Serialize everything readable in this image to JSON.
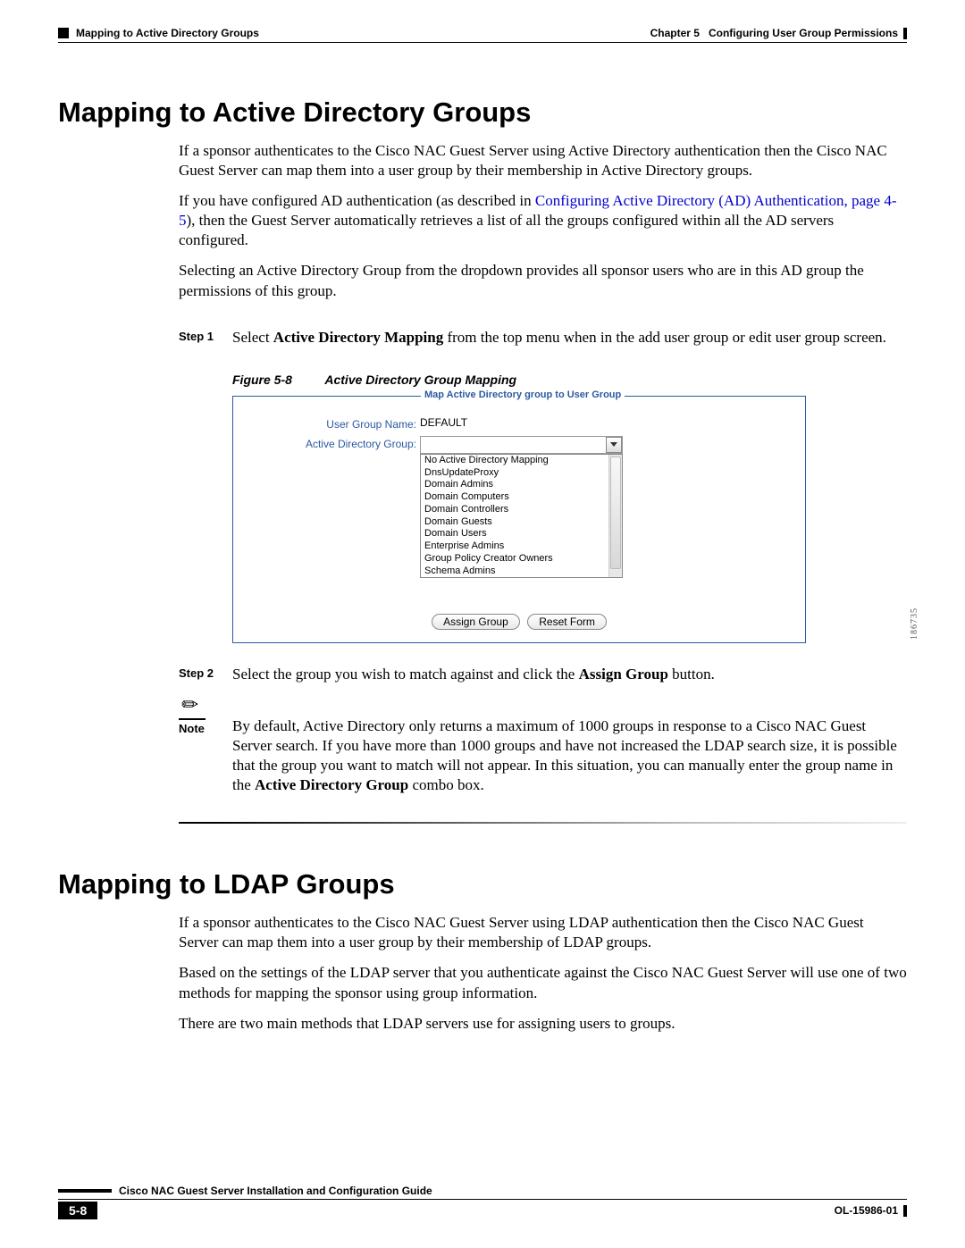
{
  "header": {
    "section_title": "Mapping to Active Directory Groups",
    "chapter_label": "Chapter 5",
    "chapter_title": "Configuring User Group Permissions"
  },
  "h1": "Mapping to Active Directory Groups",
  "p1": "If a sponsor authenticates to the Cisco NAC Guest Server using Active Directory authentication then the Cisco NAC Guest Server can map them into a user group by their membership in Active Directory groups.",
  "p2a": "If you have configured AD authentication (as described in ",
  "p2_link": "Configuring Active Directory (AD) Authentication, page 4-5",
  "p2b": "), then the Guest Server automatically retrieves a list of all the groups configured within all the AD servers configured.",
  "p3": "Selecting an Active Directory Group from the dropdown provides all sponsor users who are in this AD group the permissions of this group.",
  "step1": {
    "label": "Step 1",
    "before": "Select ",
    "bold": "Active Directory Mapping",
    "after": " from the top menu when in the add user group or edit user group screen."
  },
  "figure": {
    "label": "Figure 5-8",
    "title": "Active Directory Group Mapping",
    "legend": "Map Active Directory group to User Group",
    "row1_label": "User Group Name:",
    "row1_value": "DEFAULT",
    "row2_label": "Active Directory Group:",
    "options": [
      "No Active Directory Mapping",
      "DnsUpdateProxy",
      "Domain Admins",
      "Domain Computers",
      "Domain Controllers",
      "Domain Guests",
      "Domain Users",
      "Enterprise Admins",
      "Group Policy Creator Owners",
      "Schema Admins"
    ],
    "btn_assign": "Assign Group",
    "btn_reset": "Reset Form",
    "fig_id": "186735"
  },
  "step2": {
    "label": "Step 2",
    "before": "Select the group you wish to match against and click the ",
    "bold": "Assign Group",
    "after": " button."
  },
  "note": {
    "label": "Note",
    "t1": "By default, Active Directory only returns a maximum of 1000 groups in response to a Cisco NAC Guest Server search. If you have more than 1000 groups and have not increased the LDAP search size, it is possible that the group you want to match will not appear. In this situation, you can manually enter the group name in the ",
    "bold": "Active Directory Group",
    "t2": " combo box."
  },
  "h2": "Mapping to LDAP Groups",
  "ldap_p1": "If a sponsor authenticates to the Cisco NAC Guest Server using LDAP authentication then the Cisco NAC Guest Server can map them into a user group by their membership of LDAP groups.",
  "ldap_p2": "Based on the settings of the LDAP server that you authenticate against the Cisco NAC Guest Server will use one of two methods for mapping the sponsor using group information.",
  "ldap_p3": "There are two main methods that LDAP servers use for assigning users to groups.",
  "footer": {
    "guide_title": "Cisco NAC Guest Server Installation and Configuration Guide",
    "page_num": "5-8",
    "doc_id": "OL-15986-01"
  }
}
